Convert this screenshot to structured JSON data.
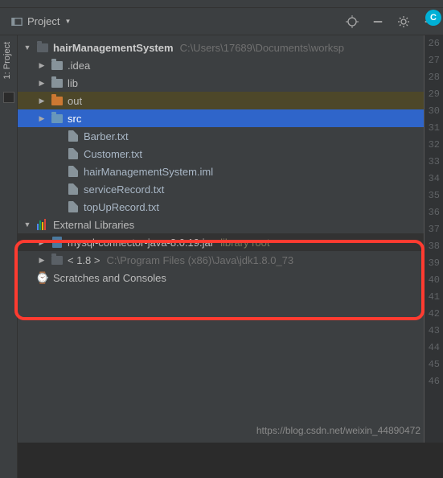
{
  "breadcrumb": {
    "project": "hairManagementSystem",
    "segment": "src"
  },
  "toolbar": {
    "view_label": "Project"
  },
  "sidetab": {
    "label": "1: Project"
  },
  "avatar": {
    "initial": "C"
  },
  "tree": {
    "root": {
      "name": "hairManagementSystem",
      "path": "C:\\Users\\17689\\Documents\\worksp"
    },
    "children": [
      {
        "name": ".idea"
      },
      {
        "name": "lib"
      },
      {
        "name": "out"
      },
      {
        "name": "src"
      }
    ],
    "files": [
      {
        "name": "Barber.txt"
      },
      {
        "name": "Customer.txt"
      },
      {
        "name": "hairManagementSystem.iml"
      },
      {
        "name": "serviceRecord.txt"
      },
      {
        "name": "topUpRecord.txt"
      }
    ],
    "external": {
      "label": "External Libraries",
      "items": [
        {
          "name": "mysql-connector-java-8.0.19.jar",
          "suffix": "library root"
        },
        {
          "name": "< 1.8 >",
          "suffix": "C:\\Program Files (x86)\\Java\\jdk1.8.0_73"
        }
      ]
    },
    "scratches": {
      "label": "Scratches and Consoles"
    }
  },
  "gutter": {
    "start": 26,
    "end": 46
  },
  "watermark": "https://blog.csdn.net/weixin_44890472"
}
